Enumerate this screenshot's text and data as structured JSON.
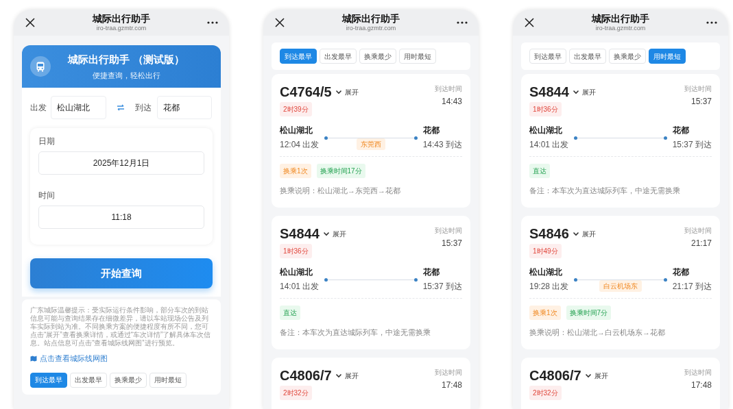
{
  "phones": [
    {
      "kind": "search",
      "header": {
        "title": "城际出行助手",
        "url": "iro-traa.gzmtr.com"
      },
      "banner": {
        "title": "城际出行助手 （测试版）",
        "subtitle": "便捷查询，轻松出行"
      },
      "route": {
        "from_label": "出发",
        "from_value": "松山湖北",
        "to_label": "到达",
        "to_value": "花都"
      },
      "date": {
        "label": "日期",
        "value": "2025年12月1日"
      },
      "time": {
        "label": "时间",
        "value": "11:18"
      },
      "search_button": "开始查询",
      "notice": "广东城际温馨提示：受实际运行条件影响，部分车次的到站信息可能与查询结果存在细微差异，请以车站现场公告及列车实际到站为准。不同换乘方案的便捷程度有所不同，您可点击“展开”查看换乘详情，或通过“车次详情”了解具体车次信息。站点信息可点击“查看城际线网图”进行预览。",
      "map_link": "点击查看城际线网图",
      "sort_tabs": [
        {
          "label": "到达最早",
          "selected": true
        },
        {
          "label": "出发最早",
          "selected": false
        },
        {
          "label": "换乘最少",
          "selected": false
        },
        {
          "label": "用时最短",
          "selected": false
        }
      ]
    },
    {
      "kind": "results",
      "header": {
        "title": "城际出行助手",
        "url": "iro-traa.gzmtr.com"
      },
      "sort_tabs": [
        {
          "label": "到达最早",
          "selected": true
        },
        {
          "label": "出发最早",
          "selected": false
        },
        {
          "label": "换乘最少",
          "selected": false
        },
        {
          "label": "用时最短",
          "selected": false
        }
      ],
      "trains": [
        {
          "number": "C4764/5",
          "expand": "展开",
          "duration": "2时39分",
          "arrival_label": "到达时间",
          "arrival_time": "14:43",
          "origin": "松山湖北",
          "departure": "12:04 出发",
          "transfer_station": "东莞西",
          "destination": "花都",
          "arrival": "14:43 到达",
          "tags": [
            {
              "label": "换乘1次",
              "kind": "transfer"
            },
            {
              "label": "换乘时间17分",
              "kind": "wait"
            }
          ],
          "note": "换乘说明：松山湖北→东莞西→花都"
        },
        {
          "number": "S4844",
          "expand": "展开",
          "duration": "1时36分",
          "arrival_label": "到达时间",
          "arrival_time": "15:37",
          "origin": "松山湖北",
          "departure": "14:01 出发",
          "destination": "花都",
          "arrival": "15:37 到达",
          "tags": [
            {
              "label": "直达",
              "kind": "direct"
            }
          ],
          "note": "备注：本车次为直达城际列车，中途无需换乘"
        },
        {
          "number": "C4806/7",
          "expand": "展开",
          "duration": "2时32分",
          "arrival_label": "到达时间",
          "arrival_time": "17:48"
        }
      ]
    },
    {
      "kind": "results",
      "header": {
        "title": "城际出行助手",
        "url": "iro-traa.gzmtr.com"
      },
      "sort_tabs": [
        {
          "label": "到达最早",
          "selected": false
        },
        {
          "label": "出发最早",
          "selected": false
        },
        {
          "label": "换乘最少",
          "selected": false
        },
        {
          "label": "用时最短",
          "selected": true
        }
      ],
      "trains": [
        {
          "number": "S4844",
          "expand": "展开",
          "duration": "1时36分",
          "arrival_label": "到达时间",
          "arrival_time": "15:37",
          "origin": "松山湖北",
          "departure": "14:01 出发",
          "destination": "花都",
          "arrival": "15:37 到达",
          "tags": [
            {
              "label": "直达",
              "kind": "direct"
            }
          ],
          "note": "备注：本车次为直达城际列车，中途无需换乘"
        },
        {
          "number": "S4846",
          "expand": "展开",
          "duration": "1时49分",
          "arrival_label": "到达时间",
          "arrival_time": "21:17",
          "origin": "松山湖北",
          "departure": "19:28 出发",
          "transfer_station": "白云机场东",
          "destination": "花都",
          "arrival": "21:17 到达",
          "tags": [
            {
              "label": "换乘1次",
              "kind": "transfer"
            },
            {
              "label": "换乘时间7分",
              "kind": "wait"
            }
          ],
          "note": "换乘说明：松山湖北→白云机场东→花都"
        },
        {
          "number": "C4806/7",
          "expand": "展开",
          "duration": "2时32分",
          "arrival_label": "到达时间",
          "arrival_time": "17:48"
        }
      ]
    }
  ]
}
